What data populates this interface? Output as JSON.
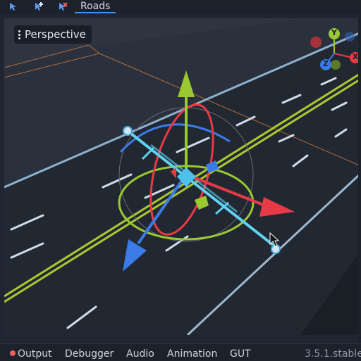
{
  "toolbar": {
    "tab_label": "Roads",
    "icons": [
      "select-nodes-icon",
      "add-node-icon",
      "remove-node-icon"
    ],
    "accent_color": "#4a8ef0"
  },
  "viewport": {
    "view_label": "Perspective",
    "gizmo_axes": {
      "x": "X",
      "y": "Y",
      "z": "Z"
    }
  },
  "bottom_panel": {
    "tabs": [
      "Output",
      "Debugger",
      "Audio",
      "Animation",
      "GUT"
    ],
    "version": "3.5.1.stable"
  }
}
